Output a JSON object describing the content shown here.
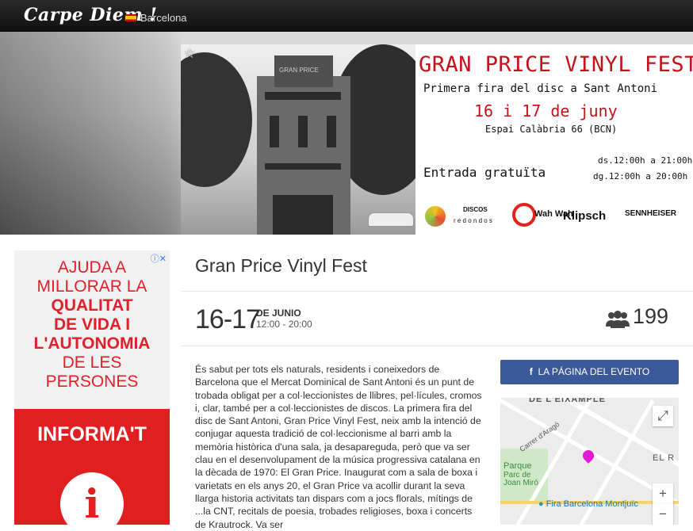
{
  "header": {
    "logo": "Carpe Diem !",
    "city": "Barcelona"
  },
  "poster": {
    "title": "GRAN PRICE VINYL FEST",
    "subtitle": "Primera fira del disc a Sant Antoni",
    "dates": "16 i 17 de juny",
    "venue": "Espai Calàbria 66 (BCN)",
    "entry": "Entrada gratuïta",
    "hours_sat": "ds.12:00h a 21:00h",
    "hours_sun": "dg.12:00h a 20:00h",
    "sponsor_discos": "DISCOS",
    "sponsor_redondos": "r e d o n d o s",
    "sponsor_wah": "Wah Wah",
    "sponsor_klipsch": "Klipsch",
    "sponsor_sennheiser": "SENNHEISER",
    "building_sign": "GRAN PRICE"
  },
  "ad": {
    "line1": "AJUDA A",
    "line2": "MILLORAR LA",
    "line3": "QUALITAT",
    "line4": "DE VIDA I",
    "line5": "L'AUTONOMIA",
    "line6": "DE LES",
    "line7": "PERSONES",
    "cta": "INFORMA'T",
    "info_glyph": "i"
  },
  "event": {
    "title": "Gran Price Vinyl Fest",
    "date_range": "16-17",
    "month": "DE JUNIO",
    "time": "12:00 - 20:00",
    "attendees": "199",
    "description": "És sabut per tots els naturals, residents i coneixedors de Barcelona que el Mercat Dominical de Sant Antoni és un punt de trobada obligat per a col·leccionistes de llibres, pel·lícules, cromos i, clar, també per a col·leccionistes de discos. La primera fira del disc de Sant Antoni, Gran Price Vinyl Fest, neix amb la intenció de conjugar aquesta tradició de col·leccionisme al barri amb la memòria històrica d'una sala, ja desapareguda, però que va ser clau en el desenvolupament de la música progressiva catalana en la dècada de 1970: El Gran Price. Inaugurat com a sala de boxa i varietats en els anys 20, el Gran Price va acollir durant la seva llarga historia activitats tan dispars com a jocs florals, mítings de ...la CNT, recitals de poesia, trobades religioses, boxa i concerts de Krautrock. Va ser",
    "facebook_button": "LA PÁGINA DEL EVENTO"
  },
  "map": {
    "label_eixample": "DE L'EIXAMPLE",
    "label_carrer": "Carrer d'Aragó",
    "label_el": "EL R",
    "label_parque": "Parque",
    "label_parc": "Parc de",
    "label_joan": "Joan Miró",
    "label_fira": "Fira Barcelona Montjuïc",
    "zoom_in": "+",
    "zoom_out": "−",
    "fullscreen": "⤢"
  },
  "colors": {
    "accent_red": "#c4121a",
    "facebook": "#3b5998",
    "ad_red": "#e02020",
    "pin": "#e21ad6"
  }
}
